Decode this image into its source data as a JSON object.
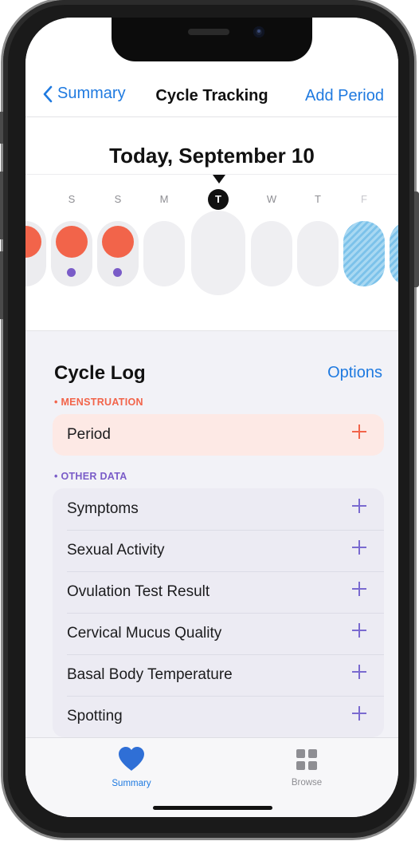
{
  "nav": {
    "back_label": "Summary",
    "title": "Cycle Tracking",
    "action_label": "Add Period"
  },
  "calendar": {
    "date_title": "Today, September 10",
    "days": [
      {
        "letter": "S",
        "state": "normal"
      },
      {
        "letter": "S",
        "state": "normal"
      },
      {
        "letter": "M",
        "state": "normal"
      },
      {
        "letter": "T",
        "state": "today"
      },
      {
        "letter": "W",
        "state": "normal"
      },
      {
        "letter": "T",
        "state": "normal"
      },
      {
        "letter": "F",
        "state": "faded"
      }
    ]
  },
  "cycle_log": {
    "title": "Cycle Log",
    "options_label": "Options",
    "menstruation_label": "• MENSTRUATION",
    "period_label": "Period",
    "other_label": "• OTHER DATA",
    "other_items": [
      "Symptoms",
      "Sexual Activity",
      "Ovulation Test Result",
      "Cervical Mucus Quality",
      "Basal Body Temperature",
      "Spotting"
    ]
  },
  "tabbar": {
    "summary_label": "Summary",
    "browse_label": "Browse"
  },
  "colors": {
    "accent_blue": "#1f7ae0",
    "period_red": "#f2644a",
    "symptom_purple": "#7a5cc8",
    "fertile_blue": "#7cc2ea"
  },
  "icons": {
    "back": "chevron-left-icon",
    "summary_tab": "heart-icon",
    "browse_tab": "grid-icon",
    "add": "plus-icon"
  }
}
